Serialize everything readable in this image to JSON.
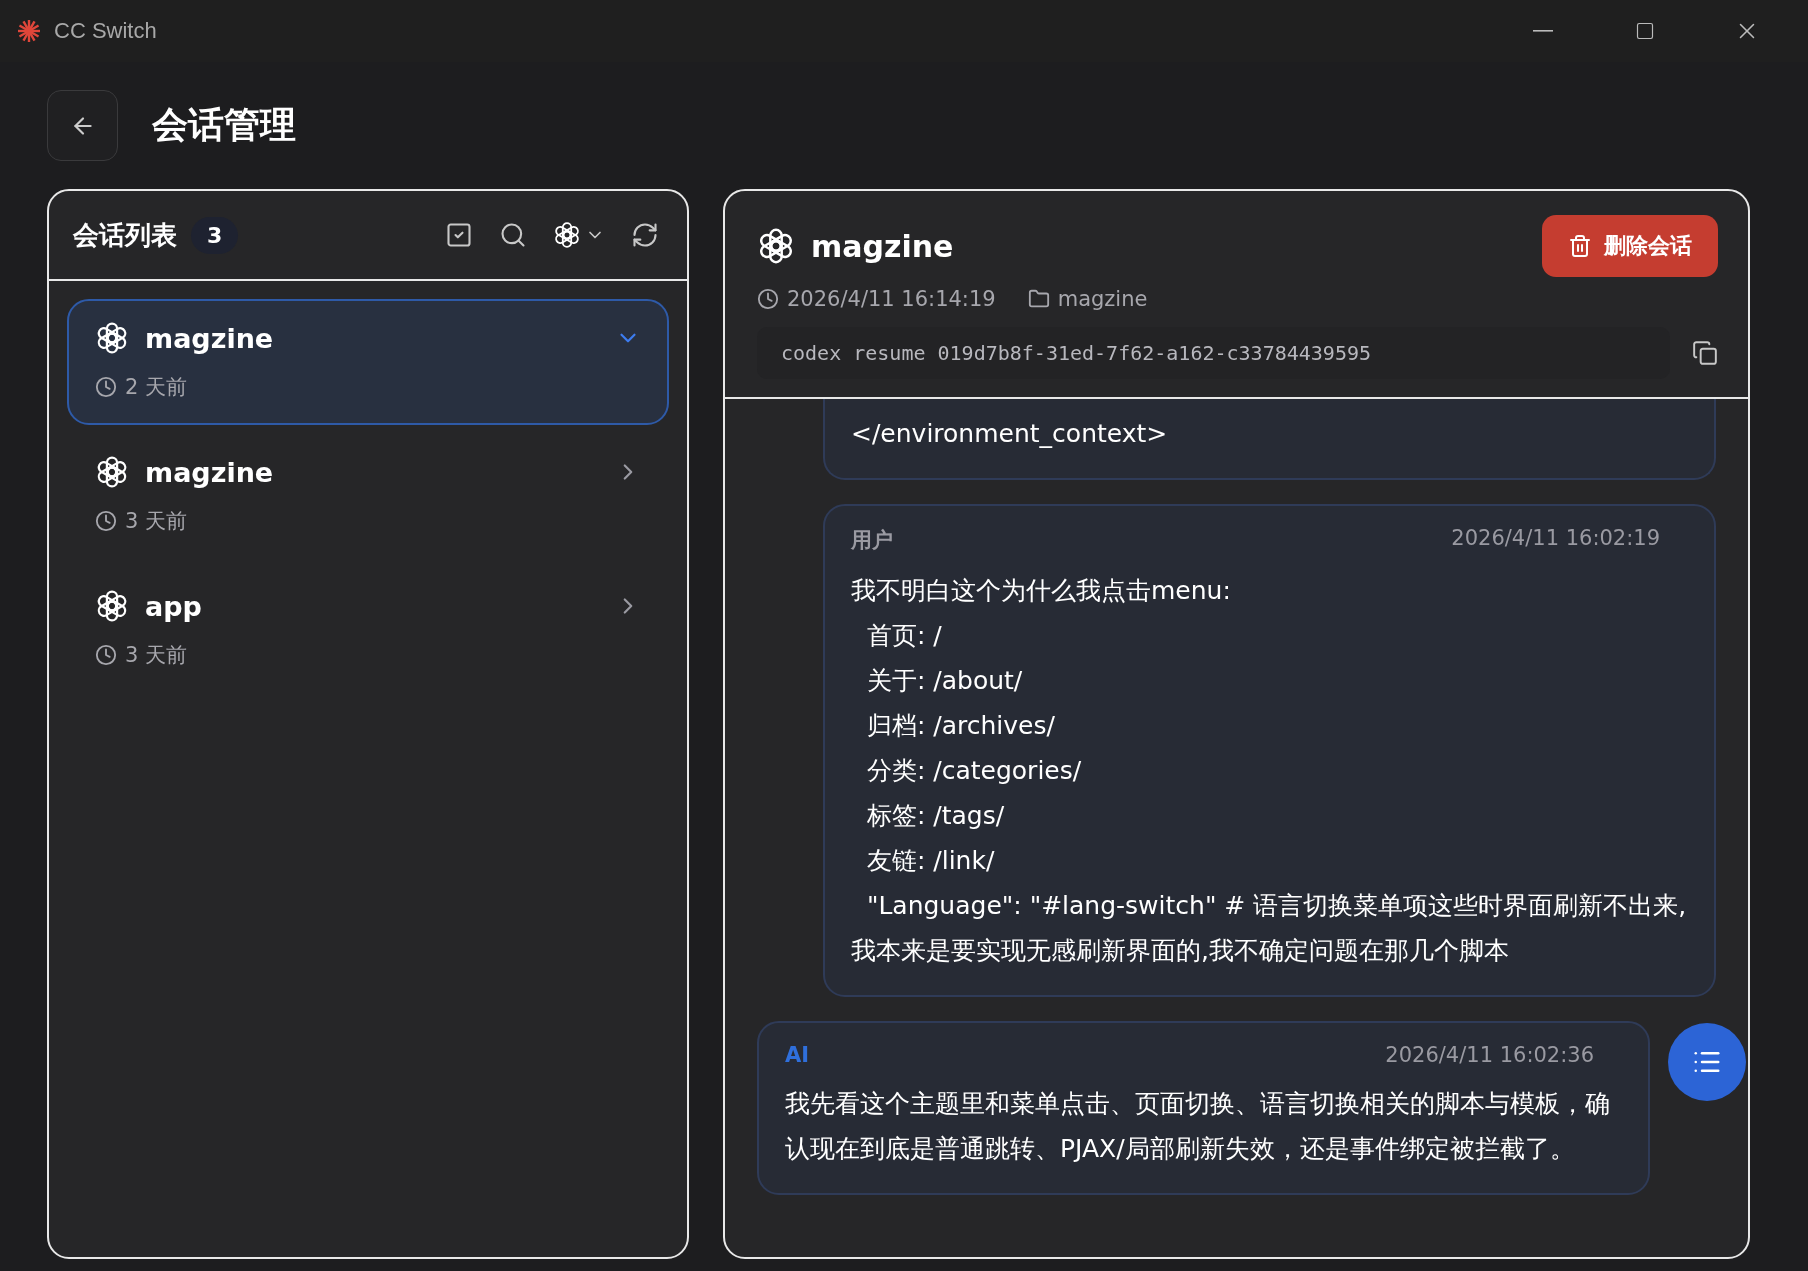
{
  "window": {
    "title": "CC Switch"
  },
  "page": {
    "title": "会话管理"
  },
  "session_list": {
    "title": "会话列表",
    "count": "3",
    "items": [
      {
        "name": "magzine",
        "time": "2 天前",
        "selected": true
      },
      {
        "name": "magzine",
        "time": "3 天前",
        "selected": false
      },
      {
        "name": "app",
        "time": "3 天前",
        "selected": false
      }
    ]
  },
  "detail": {
    "title": "magzine",
    "timestamp": "2026/4/11 16:14:19",
    "folder": "magzine",
    "command": "codex resume 019d7b8f-31ed-7f62-a162-c33784439595",
    "delete_label": "删除会话",
    "messages": [
      {
        "kind": "partial",
        "text": "</environment_context>"
      },
      {
        "kind": "user",
        "role": "用户",
        "time": "2026/4/11 16:02:19",
        "text": "我不明白这个为什么我点击menu:\n  首页: /\n  关于: /about/\n  归档: /archives/\n  分类: /categories/\n  标签: /tags/\n  友链: /link/\n  \"Language\": \"#lang-switch\" # 语言切换菜单项这些时界面刷新不出来,我本来是要实现无感刷新界面的,我不确定问题在那几个脚本"
      },
      {
        "kind": "ai",
        "role": "AI",
        "time": "2026/4/11 16:02:36",
        "text": "我先看这个主题里和菜单点击、页面切换、语言切换相关的脚本与模板，确认现在到底是普通跳转、PJAX/局部刷新失效，还是事件绑定被拦截了。"
      }
    ]
  }
}
